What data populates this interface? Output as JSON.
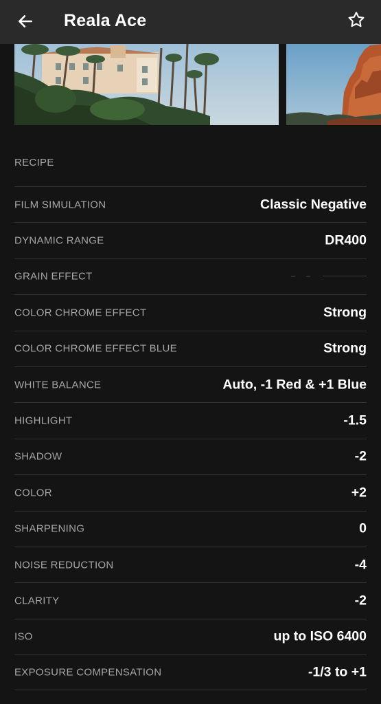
{
  "header": {
    "title": "Reala Ace",
    "back_icon": "arrow-left-icon",
    "favorite_icon": "star-outline-icon"
  },
  "carousel": {
    "photos": [
      {
        "subject": "mansion-with-palm-trees"
      },
      {
        "subject": "red-rock-cliffs"
      }
    ]
  },
  "recipe": {
    "section_label": "RECIPE",
    "items": [
      {
        "label": "FILM SIMULATION",
        "value": "Classic Negative"
      },
      {
        "label": "DYNAMIC RANGE",
        "value": "DR400"
      },
      {
        "label": "GRAIN EFFECT",
        "value": ""
      },
      {
        "label": "COLOR CHROME EFFECT",
        "value": "Strong"
      },
      {
        "label": "COLOR CHROME EFFECT BLUE",
        "value": "Strong"
      },
      {
        "label": "WHITE BALANCE",
        "value": "Auto, -1 Red & +1 Blue"
      },
      {
        "label": "HIGHLIGHT",
        "value": "-1.5"
      },
      {
        "label": "SHADOW",
        "value": "-2"
      },
      {
        "label": "COLOR",
        "value": "+2"
      },
      {
        "label": "SHARPENING",
        "value": "0"
      },
      {
        "label": "NOISE REDUCTION",
        "value": "-4"
      },
      {
        "label": "CLARITY",
        "value": "-2"
      },
      {
        "label": "ISO",
        "value": "up to ISO 6400"
      },
      {
        "label": "EXPOSURE COMPENSATION",
        "value": "-1/3 to +1"
      }
    ]
  },
  "colors": {
    "background": "#141414",
    "header": "#2a2a2a",
    "label": "#a6a6a6",
    "value": "#ffffff",
    "divider": "#333333"
  }
}
